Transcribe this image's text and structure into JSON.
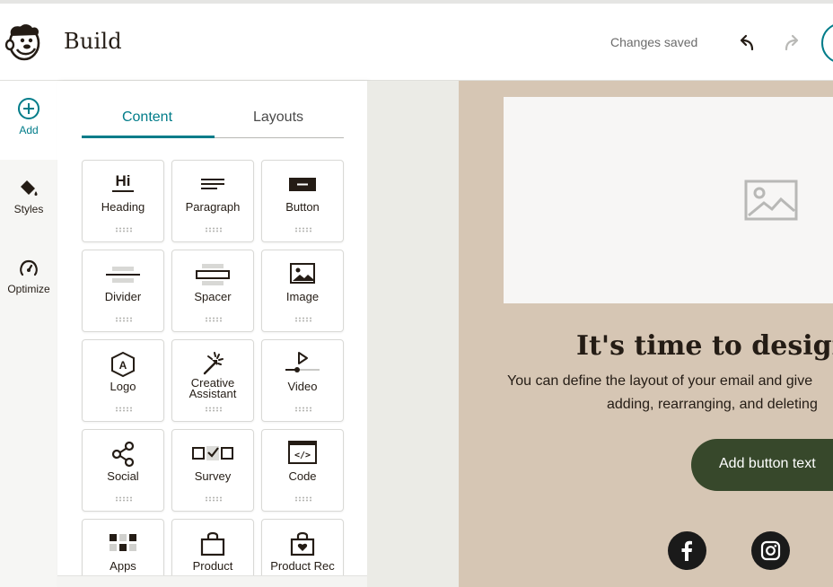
{
  "header": {
    "title": "Build",
    "status": "Changes saved",
    "logo_icon": "mailchimp-freddie-logo",
    "undo_icon": "undo-icon",
    "redo_icon": "redo-icon"
  },
  "rail": {
    "items": [
      {
        "label": "Add",
        "icon": "plus-circle-icon"
      },
      {
        "label": "Styles",
        "icon": "paint-bucket-icon"
      },
      {
        "label": "Optimize",
        "icon": "gauge-icon"
      }
    ]
  },
  "panel": {
    "tabs": [
      {
        "label": "Content",
        "active": true
      },
      {
        "label": "Layouts",
        "active": false
      }
    ],
    "blocks": [
      {
        "label": "Heading",
        "icon": "heading-icon",
        "glyph": "Hi"
      },
      {
        "label": "Paragraph",
        "icon": "paragraph-icon"
      },
      {
        "label": "Button",
        "icon": "button-icon"
      },
      {
        "label": "Divider",
        "icon": "divider-icon"
      },
      {
        "label": "Spacer",
        "icon": "spacer-icon"
      },
      {
        "label": "Image",
        "icon": "image-icon"
      },
      {
        "label": "Logo",
        "icon": "logo-hexagon-icon",
        "glyph": "A"
      },
      {
        "label": "Creative Assistant",
        "icon": "magic-wand-icon"
      },
      {
        "label": "Video",
        "icon": "video-icon"
      },
      {
        "label": "Social",
        "icon": "share-icon"
      },
      {
        "label": "Survey",
        "icon": "survey-icon"
      },
      {
        "label": "Code",
        "icon": "code-icon",
        "glyph": "</>"
      },
      {
        "label": "Apps",
        "icon": "apps-icon"
      },
      {
        "label": "Product",
        "icon": "shopping-bag-icon"
      },
      {
        "label": "Product Rec",
        "icon": "product-rec-icon"
      }
    ]
  },
  "email": {
    "headline": "It's time to design y",
    "body_line1": "You can define the layout of your email and give",
    "body_line2": "adding, rearranging, and deleting",
    "button_label": "Add button text",
    "socials": [
      "facebook-icon",
      "instagram-icon"
    ]
  },
  "colors": {
    "accent": "#007c89",
    "email_background": "#d6c6b4",
    "button": "#37482b",
    "canvas": "#ebebe6"
  }
}
